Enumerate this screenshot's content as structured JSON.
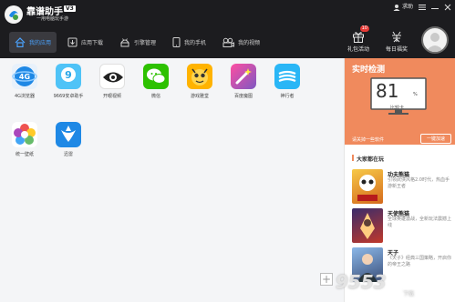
{
  "app": {
    "title": "靠谱助手",
    "version": "V3",
    "subtitle": "一用电脑玩手游"
  },
  "window_controls": {
    "feedback": "求助",
    "menu_icon": "menu-icon",
    "minimize_icon": "minimize-icon",
    "close_icon": "close-icon"
  },
  "nav": [
    {
      "label": "我的应用",
      "icon": "home-icon",
      "active": true
    },
    {
      "label": "应用下载",
      "icon": "download-icon",
      "active": false
    },
    {
      "label": "引擎管理",
      "icon": "android-icon",
      "active": false
    },
    {
      "label": "我的手机",
      "icon": "phone-icon",
      "active": false
    },
    {
      "label": "我的视频",
      "icon": "video-icon",
      "active": false
    }
  ],
  "header_actions": {
    "gift": {
      "label": "礼包活动",
      "badge": "10"
    },
    "reward": {
      "label": "每日福奖"
    }
  },
  "apps": [
    {
      "label": "4G浏览器",
      "icon": "4g-browser-icon"
    },
    {
      "label": "9669安卓助手",
      "icon": "9669-assistant-icon"
    },
    {
      "label": "开眼视频",
      "icon": "eye-video-icon"
    },
    {
      "label": "微信",
      "icon": "wechat-icon"
    },
    {
      "label": "游戏雅堂",
      "icon": "game-hall-icon"
    },
    {
      "label": "百度魔图",
      "icon": "baidu-motu-icon"
    },
    {
      "label": "神行者",
      "icon": "shenxingzhe-icon"
    },
    {
      "label": "统一壁纸",
      "icon": "wallpaper-icon"
    },
    {
      "label": "迅雷",
      "icon": "xunlei-icon"
    }
  ],
  "realtime": {
    "title": "实时检测",
    "score": "81",
    "unit": "%",
    "score_text": "比较卡",
    "tip": "请关掉一些软件",
    "button": "一键加速",
    "color": "#f08a5d"
  },
  "playing": {
    "title": "大家都在玩",
    "games": [
      {
        "name": "功夫熊猫",
        "desc": "引领武侠风格2.0时代，热血手游新王者"
      },
      {
        "name": "天使熊猫",
        "desc": "全球英雄激战，全新玩法震撼上线"
      },
      {
        "name": "天子",
        "desc": "《天子》经典三国策略，开启你的帝王之路"
      }
    ]
  },
  "watermark": {
    "text": "9553",
    "sub": "下载"
  }
}
